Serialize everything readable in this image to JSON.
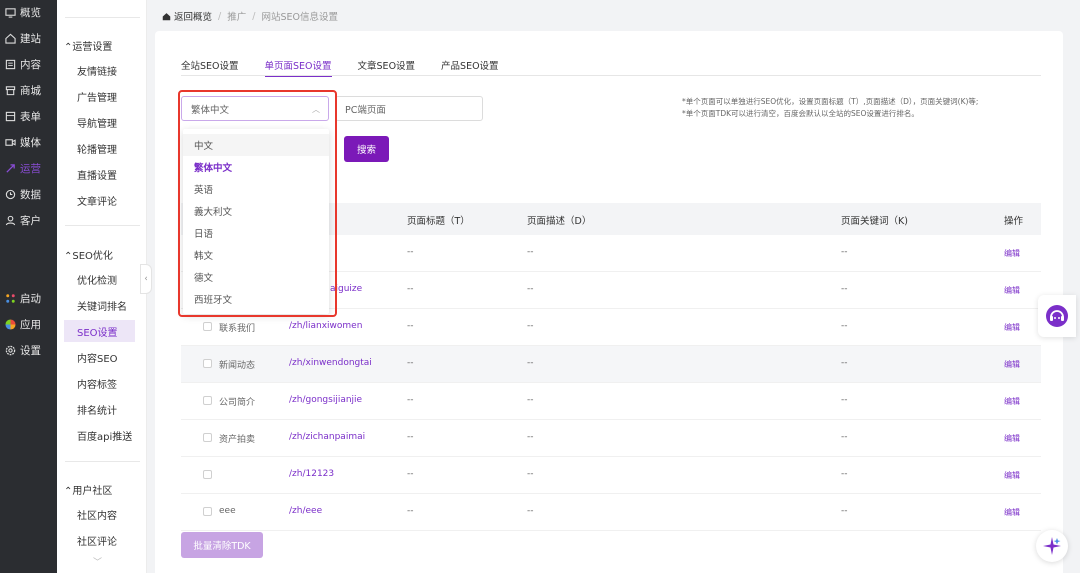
{
  "nav": {
    "items": [
      {
        "label": "概览",
        "icon": "overview-icon"
      },
      {
        "label": "建站",
        "icon": "home-icon"
      },
      {
        "label": "内容",
        "icon": "content-icon"
      },
      {
        "label": "商城",
        "icon": "store-icon"
      },
      {
        "label": "表单",
        "icon": "form-icon"
      },
      {
        "label": "媒体",
        "icon": "media-icon"
      },
      {
        "label": "运营",
        "icon": "operation-icon",
        "active": true
      },
      {
        "label": "数据",
        "icon": "data-icon"
      },
      {
        "label": "客户",
        "icon": "user-icon"
      }
    ],
    "bottom": [
      {
        "label": "启动",
        "icon": "launch-icon"
      },
      {
        "label": "应用",
        "icon": "apps-icon"
      },
      {
        "label": "设置",
        "icon": "settings-icon"
      }
    ]
  },
  "subnav": {
    "group1": "运营设置",
    "group1_items": [
      "友情链接",
      "广告管理",
      "导航管理",
      "轮播管理",
      "直播设置",
      "文章评论"
    ],
    "group2": "SEO优化",
    "group2_items": [
      "优化检测",
      "关键词排名",
      "SEO设置",
      "内容SEO",
      "内容标签",
      "排名统计",
      "百度api推送"
    ],
    "group3": "用户社区",
    "group3_items": [
      "社区内容",
      "社区评论"
    ]
  },
  "breadcrumb": {
    "back": "返回概览",
    "level1": "推广",
    "level2": "网站SEO信息设置"
  },
  "tabs": [
    "全站SEO设置",
    "单页面SEO设置",
    "文章SEO设置",
    "产品SEO设置"
  ],
  "filters": {
    "language": "繁体中文",
    "page_type": "PC端页面",
    "search_label": "搜索"
  },
  "tips": {
    "line1": "*单个页面可以单独进行SEO优化，设置页面标题（T）,页面描述（D），页面关键词(K)等;",
    "line2": "*单个页面TDK可以进行清空，百度会默认以全站的SEO设置进行排名。"
  },
  "table": {
    "headers": {
      "title": "页面标题（T）",
      "desc": "页面描述（D）",
      "keywords": "页面关键词（K)",
      "action": "操作"
    },
    "rows": [
      {
        "name": "",
        "path": "",
        "title": "--",
        "desc": "--",
        "keywords": "--",
        "action": "编辑"
      },
      {
        "name": "",
        "path": "aiguize",
        "title": "--",
        "desc": "--",
        "keywords": "--",
        "action": "编辑"
      },
      {
        "name": "联系我们",
        "path": "/zh/lianxiwomen",
        "title": "--",
        "desc": "--",
        "keywords": "--",
        "action": "编辑"
      },
      {
        "name": "新闻动态",
        "path": "/zh/xinwendongtai",
        "title": "--",
        "desc": "--",
        "keywords": "--",
        "action": "编辑"
      },
      {
        "name": "公司简介",
        "path": "/zh/gongsijianjie",
        "title": "--",
        "desc": "--",
        "keywords": "--",
        "action": "编辑"
      },
      {
        "name": "资产拍卖",
        "path": "/zh/zichanpaimai",
        "title": "--",
        "desc": "--",
        "keywords": "--",
        "action": "编辑"
      },
      {
        "name": "",
        "path": "/zh/12123",
        "title": "--",
        "desc": "--",
        "keywords": "--",
        "action": "编辑"
      },
      {
        "name": "eee",
        "path": "/zh/eee",
        "title": "--",
        "desc": "--",
        "keywords": "--",
        "action": "编辑"
      }
    ]
  },
  "batch_button": "批量清除TDK",
  "dropdown": {
    "options": [
      "中文",
      "繁体中文",
      "英语",
      "義大利文",
      "日语",
      "韩文",
      "德文",
      "西班牙文"
    ],
    "selected": "繁体中文"
  },
  "colors": {
    "accent": "#7b2fc9",
    "sidebar_bg": "#2b2d31",
    "highlight_border": "#e8372c"
  }
}
